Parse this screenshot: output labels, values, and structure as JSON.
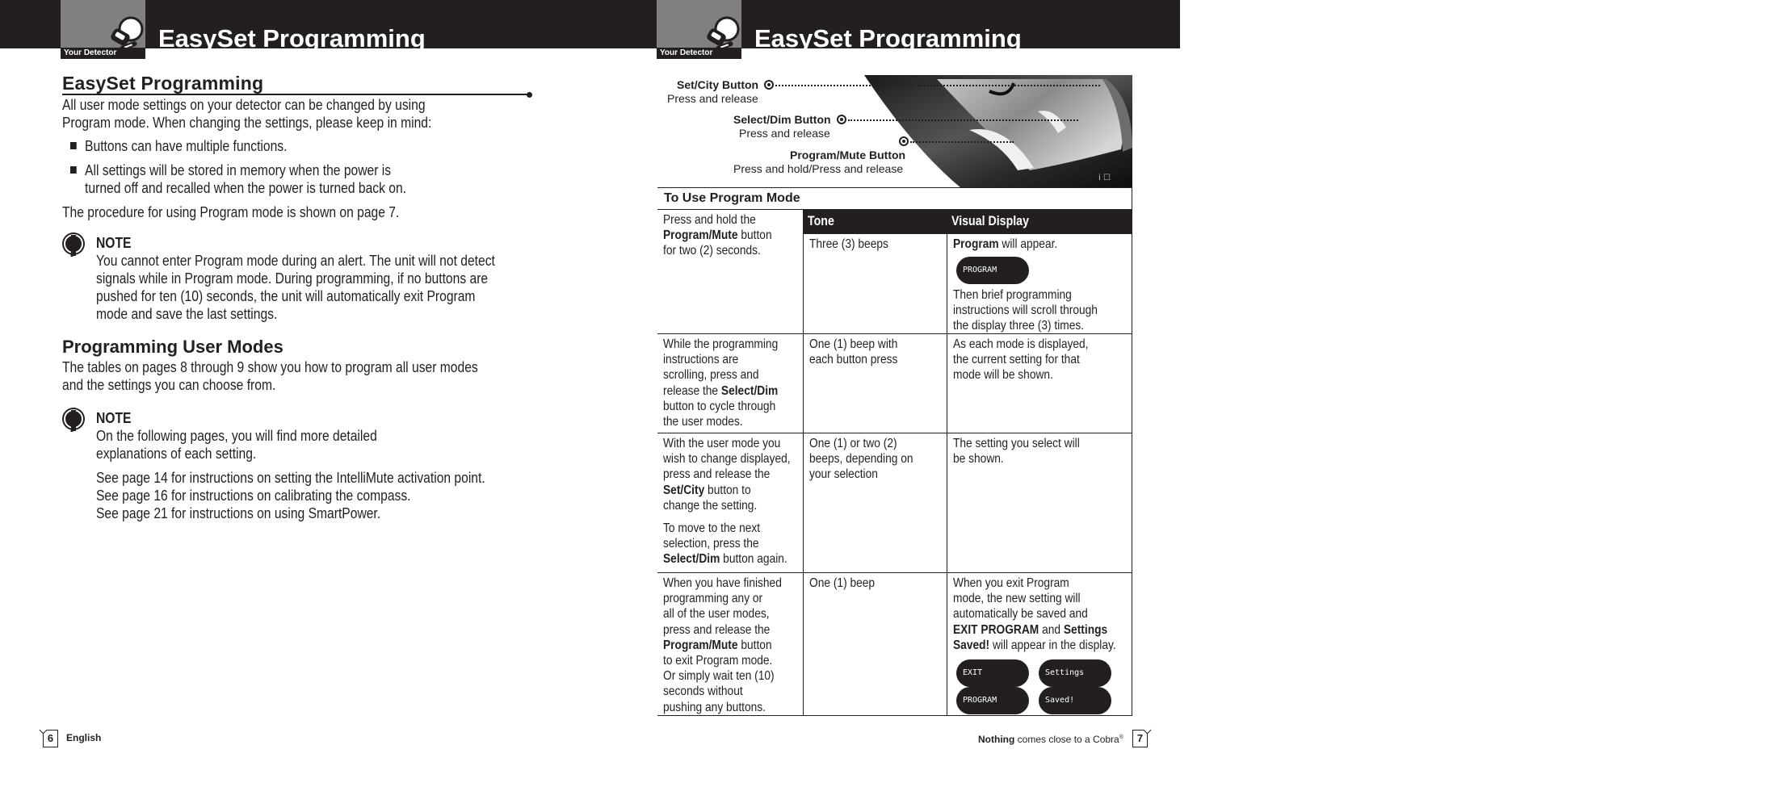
{
  "pages": [
    {
      "header": {
        "tab_label": "Your Detector",
        "title": "EasySet Programming"
      },
      "footer": {
        "page_number": "6",
        "label": "English"
      }
    },
    {
      "header": {
        "tab_label": "Your Detector",
        "title": "EasySet Programming"
      },
      "footer": {
        "page_number": "7",
        "tagline_bold": "Nothing",
        "tagline_rest": " comes close to a Cobra",
        "registered_mark": "®"
      }
    }
  ],
  "left": {
    "heading": "EasySet Programming",
    "intro": [
      "All user mode settings on your detector can be changed by using",
      "Program mode. When changing the settings, please keep in mind:"
    ],
    "bullets": [
      [
        "Buttons can have multiple functions."
      ],
      [
        "All settings will be stored in memory when the power is",
        "turned off and recalled when the power is turned back on."
      ]
    ],
    "procedure": "The procedure for using Program mode is shown on page 7.",
    "note1": {
      "title": "NOTE",
      "lines": [
        "You cannot enter Program mode during an alert. The unit will not detect",
        "signals while in Program mode. During programming, if no buttons are",
        "pushed for ten (10) seconds, the unit will automatically exit Program",
        "mode and save the last settings."
      ]
    },
    "subheading": "Programming User Modes",
    "sub_text": [
      "The tables on pages 8 through 9 show you how to program all user modes",
      "and the settings you can choose from."
    ],
    "note2": {
      "title": "NOTE",
      "lines": [
        "On the following pages, you will find more detailed",
        "explanations of each setting."
      ],
      "refs": [
        "See page 14 for instructions on setting the IntelliMute activation point.",
        "See page 16 for instructions on calibrating the compass.",
        "See page 21 for instructions on using SmartPower."
      ]
    }
  },
  "callouts": [
    {
      "name": "Set/City Button",
      "action": "Press and release"
    },
    {
      "name": "Select/Dim Button",
      "action": "Press and release"
    },
    {
      "name": "Program/Mute Button",
      "action": "Press and hold/Press and release"
    }
  ],
  "table": {
    "title": "To Use Program Mode",
    "columns": [
      "Tone",
      "Visual Display"
    ],
    "rows": [
      {
        "step": [
          [
            "Press and hold the"
          ],
          [
            {
              "b": "Program/Mute"
            },
            " button"
          ],
          [
            "for two (2) seconds."
          ]
        ],
        "tone": [
          "Three (3) beeps"
        ],
        "display_top": [
          [
            {
              "b": "Program"
            },
            " will appear."
          ]
        ],
        "lcd": [
          "PROGRAM"
        ],
        "display_bottom": [
          "Then brief programming",
          "instructions will scroll through",
          "the display three (3) times."
        ]
      },
      {
        "step": [
          [
            "While the programming"
          ],
          [
            "instructions are"
          ],
          [
            "scrolling, press and"
          ],
          [
            "release the ",
            {
              "b": "Select/Dim"
            }
          ],
          [
            "button to cycle through"
          ],
          [
            "the user modes."
          ]
        ],
        "tone": [
          "One (1) beep with",
          "each button press"
        ],
        "display_top": [
          [
            "As each mode is displayed,"
          ],
          [
            "the current setting for that"
          ],
          [
            "mode will be shown."
          ]
        ]
      },
      {
        "step": [
          [
            "With the user mode you"
          ],
          [
            "wish to change displayed,"
          ],
          [
            "press and release the"
          ],
          [
            {
              "b": "Set/City"
            },
            " button to"
          ],
          [
            "change the setting."
          ]
        ],
        "step2": [
          [
            "To move to the next"
          ],
          [
            "selection, press the"
          ],
          [
            {
              "b": "Select/Dim"
            },
            " button again."
          ]
        ],
        "tone": [
          "One (1) or two (2)",
          "beeps, depending on",
          "your selection"
        ],
        "display_top": [
          [
            "The setting you select will"
          ],
          [
            "be shown."
          ]
        ]
      },
      {
        "step": [
          [
            "When you have finished"
          ],
          [
            "programming any or"
          ],
          [
            "all of the user modes,"
          ],
          [
            "press and release the"
          ],
          [
            {
              "b": "Program/Mute"
            },
            " button"
          ],
          [
            "to exit Program mode."
          ],
          [
            "Or simply wait ten (10)"
          ],
          [
            "seconds without"
          ],
          [
            "pushing any buttons."
          ]
        ],
        "tone": [
          "One (1) beep"
        ],
        "display_top": [
          [
            "When you exit Program"
          ],
          [
            "mode, the new setting will"
          ],
          [
            "automatically be saved and"
          ],
          [
            {
              "b": "EXIT PROGRAM"
            },
            " and ",
            {
              "b": "Settings"
            }
          ],
          [
            {
              "b": "Saved!"
            },
            " will appear in the display."
          ]
        ],
        "lcd_pairs": [
          [
            "EXIT",
            "PROGRAM"
          ],
          [
            "Settings",
            "Saved!"
          ]
        ]
      }
    ]
  },
  "colors": {
    "ink": "#231f20",
    "tab_gray": "#808080",
    "paper": "#ffffff"
  }
}
